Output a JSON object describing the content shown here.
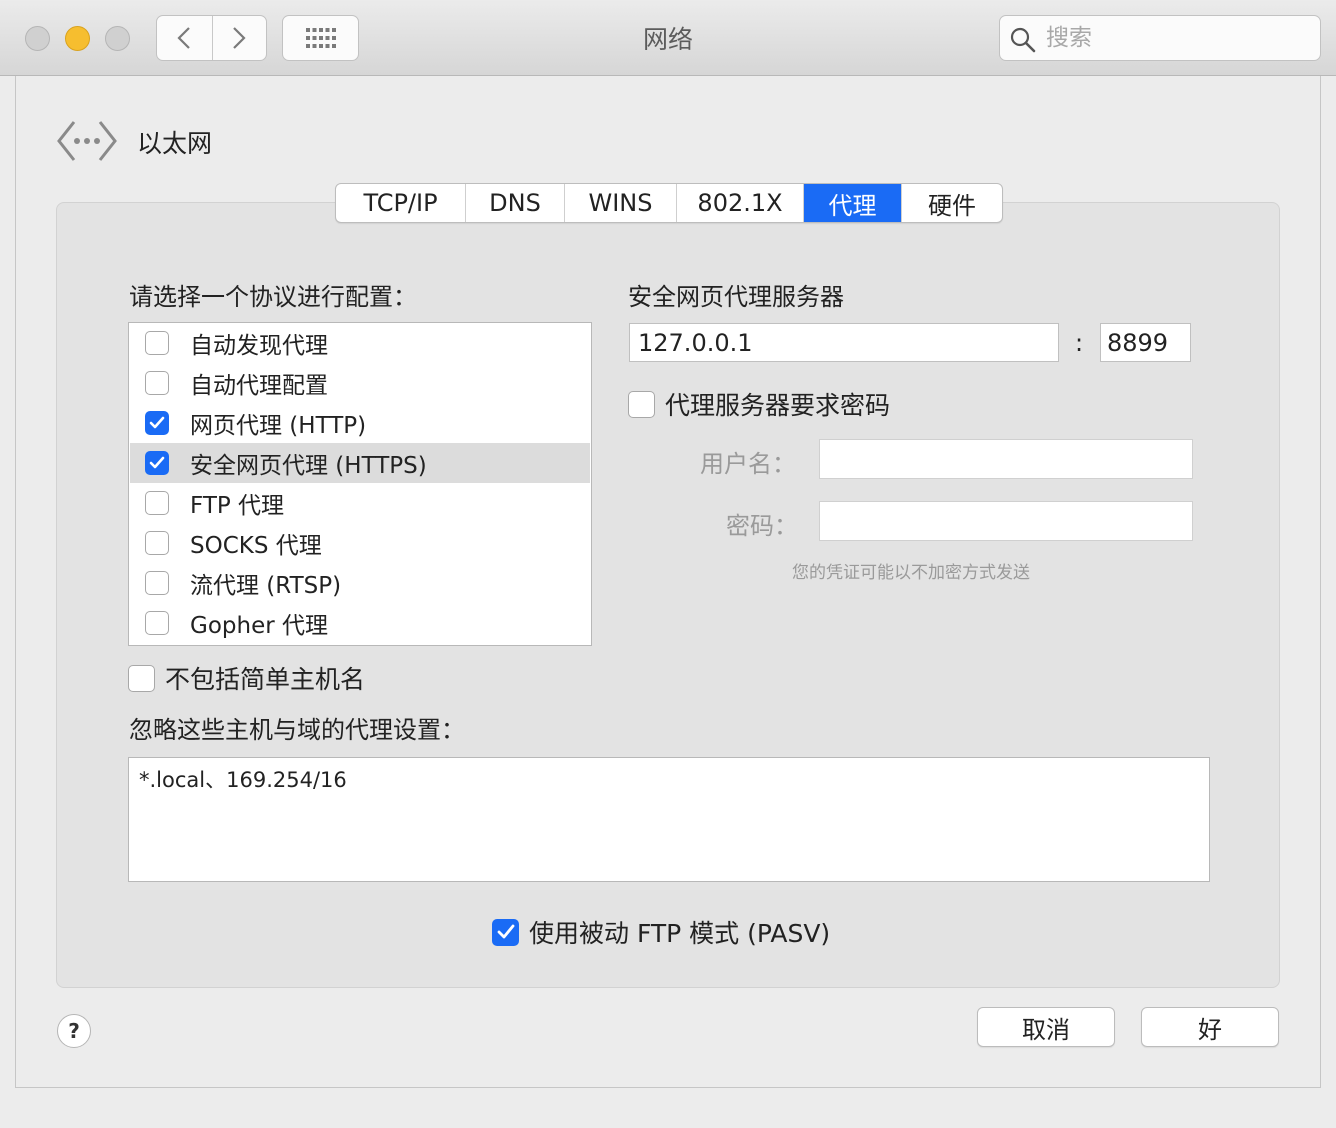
{
  "window": {
    "title": "网络",
    "search_placeholder": "搜索"
  },
  "header": {
    "interface_name": "以太网"
  },
  "tabs": [
    {
      "label": "TCP/IP"
    },
    {
      "label": "DNS"
    },
    {
      "label": "WINS"
    },
    {
      "label": "802.1X"
    },
    {
      "label": "代理",
      "active": true
    },
    {
      "label": "硬件"
    }
  ],
  "protocols": {
    "heading": "请选择一个协议进行配置：",
    "items": [
      {
        "label": "自动发现代理",
        "checked": false
      },
      {
        "label": "自动代理配置",
        "checked": false
      },
      {
        "label": "网页代理 (HTTP)",
        "checked": true
      },
      {
        "label": "安全网页代理 (HTTPS)",
        "checked": true,
        "selected": true
      },
      {
        "label": "FTP 代理",
        "checked": false
      },
      {
        "label": "SOCKS 代理",
        "checked": false
      },
      {
        "label": "流代理 (RTSP)",
        "checked": false
      },
      {
        "label": "Gopher 代理",
        "checked": false
      }
    ]
  },
  "proxy_server": {
    "heading": "安全网页代理服务器",
    "host": "127.0.0.1",
    "separator": ":",
    "port": "8899",
    "requires_password_label": "代理服务器要求密码",
    "requires_password": false,
    "username_label": "用户名：",
    "username": "",
    "password_label": "密码：",
    "password": "",
    "notice": "您的凭证可能以不加密方式发送"
  },
  "exclude_simple_hostnames": {
    "label": "不包括简单主机名",
    "checked": false
  },
  "bypass": {
    "heading": "忽略这些主机与域的代理设置：",
    "value": "*.local、169.254/16"
  },
  "passive_ftp": {
    "label": "使用被动 FTP 模式 (PASV)",
    "checked": true
  },
  "buttons": {
    "help": "?",
    "cancel": "取消",
    "ok": "好"
  },
  "colors": {
    "accent": "#1a6bf5",
    "minimize": "#f6be2f"
  }
}
